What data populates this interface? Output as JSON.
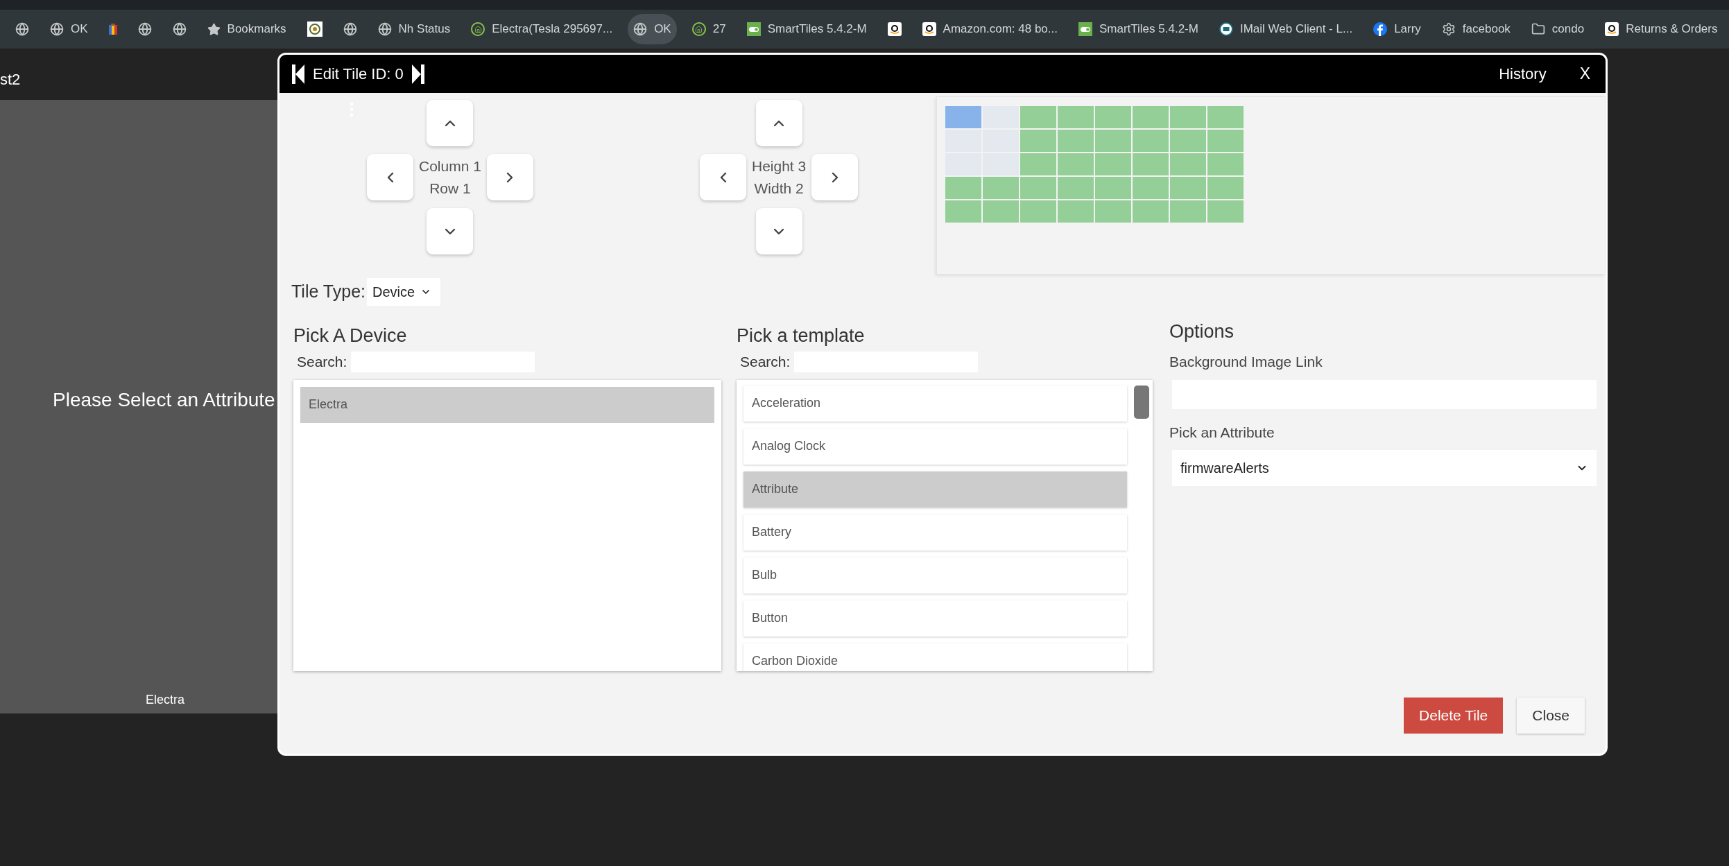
{
  "bookmarks": [
    {
      "kind": "globe",
      "highlighted": false
    },
    {
      "kind": "globe",
      "label": "OK",
      "highlighted": false
    },
    {
      "kind": "colorbar",
      "highlighted": false
    },
    {
      "kind": "globe",
      "highlighted": false
    },
    {
      "kind": "globe",
      "highlighted": false
    },
    {
      "kind": "star",
      "label": "Bookmarks",
      "highlighted": false
    },
    {
      "kind": "badge",
      "highlighted": false
    },
    {
      "kind": "globe",
      "highlighted": false
    },
    {
      "kind": "globe",
      "label": "Nh Status",
      "highlighted": false
    },
    {
      "kind": "house",
      "label": "Electra(Tesla 295697...",
      "highlighted": false
    },
    {
      "kind": "globe",
      "label": "OK",
      "highlighted": true
    },
    {
      "kind": "house",
      "label": "27",
      "highlighted": false
    },
    {
      "kind": "toggle",
      "label": "SmartTiles 5.4.2-M",
      "highlighted": false
    },
    {
      "kind": "amazon",
      "highlighted": false
    },
    {
      "kind": "amazon",
      "label": "Amazon.com: 48 bo...",
      "highlighted": false
    },
    {
      "kind": "toggle",
      "label": "SmartTiles 5.4.2-M",
      "highlighted": false
    },
    {
      "kind": "mail",
      "label": "IMail Web Client - L...",
      "highlighted": false
    },
    {
      "kind": "facebook",
      "label": "Larry",
      "highlighted": false
    },
    {
      "kind": "gear",
      "label": "facebook",
      "highlighted": false
    },
    {
      "kind": "folder",
      "label": "condo",
      "highlighted": false
    },
    {
      "kind": "amazon",
      "label": "Returns & Orders",
      "highlighted": false
    }
  ],
  "page": {
    "tab_label": "st2",
    "tile": {
      "message": "Please Select an Attribute",
      "label": "Electra"
    }
  },
  "modal": {
    "title": "Edit Tile ID: 0",
    "history": "History",
    "close": "X",
    "position": {
      "line1": "Column 1",
      "line2": "Row 1"
    },
    "size": {
      "line1": "Height 3",
      "line2": "Width 2"
    },
    "grid": [
      [
        {
          "kind": "origin"
        },
        {
          "kind": "span"
        },
        {
          "kind": "free"
        },
        {
          "kind": "free"
        },
        {
          "kind": "free"
        },
        {
          "kind": "free"
        },
        {
          "kind": "free"
        },
        {
          "kind": "free"
        }
      ],
      [
        {
          "kind": "span"
        },
        {
          "kind": "span"
        },
        {
          "kind": "free"
        },
        {
          "kind": "free"
        },
        {
          "kind": "free"
        },
        {
          "kind": "free"
        },
        {
          "kind": "free"
        },
        {
          "kind": "free"
        }
      ],
      [
        {
          "kind": "span"
        },
        {
          "kind": "span"
        },
        {
          "kind": "free"
        },
        {
          "kind": "free"
        },
        {
          "kind": "free"
        },
        {
          "kind": "free"
        },
        {
          "kind": "free"
        },
        {
          "kind": "free"
        }
      ],
      [
        {
          "kind": "free"
        },
        {
          "kind": "free"
        },
        {
          "kind": "free"
        },
        {
          "kind": "free"
        },
        {
          "kind": "free"
        },
        {
          "kind": "free"
        },
        {
          "kind": "free"
        },
        {
          "kind": "free"
        }
      ],
      [
        {
          "kind": "free"
        },
        {
          "kind": "free"
        },
        {
          "kind": "free"
        },
        {
          "kind": "free"
        },
        {
          "kind": "free"
        },
        {
          "kind": "free"
        },
        {
          "kind": "free"
        },
        {
          "kind": "free"
        }
      ]
    ],
    "tile_type": {
      "label": "Tile Type:",
      "value": "Device"
    },
    "device_picker": {
      "title": "Pick A Device",
      "search_label": "Search:",
      "items": [
        {
          "label": "Electra",
          "selected": true
        }
      ]
    },
    "template_picker": {
      "title": "Pick a template",
      "search_label": "Search:",
      "items": [
        {
          "label": "Acceleration",
          "selected": false
        },
        {
          "label": "Analog Clock",
          "selected": false
        },
        {
          "label": "Attribute",
          "selected": true
        },
        {
          "label": "Battery",
          "selected": false
        },
        {
          "label": "Bulb",
          "selected": false
        },
        {
          "label": "Button",
          "selected": false
        },
        {
          "label": "Carbon Dioxide",
          "selected": false
        }
      ]
    },
    "options": {
      "title": "Options",
      "background_label": "Background Image Link",
      "attribute_label": "Pick an Attribute",
      "attribute_value": "firmwareAlerts"
    },
    "delete_button": "Delete Tile",
    "close_button": "Close"
  }
}
